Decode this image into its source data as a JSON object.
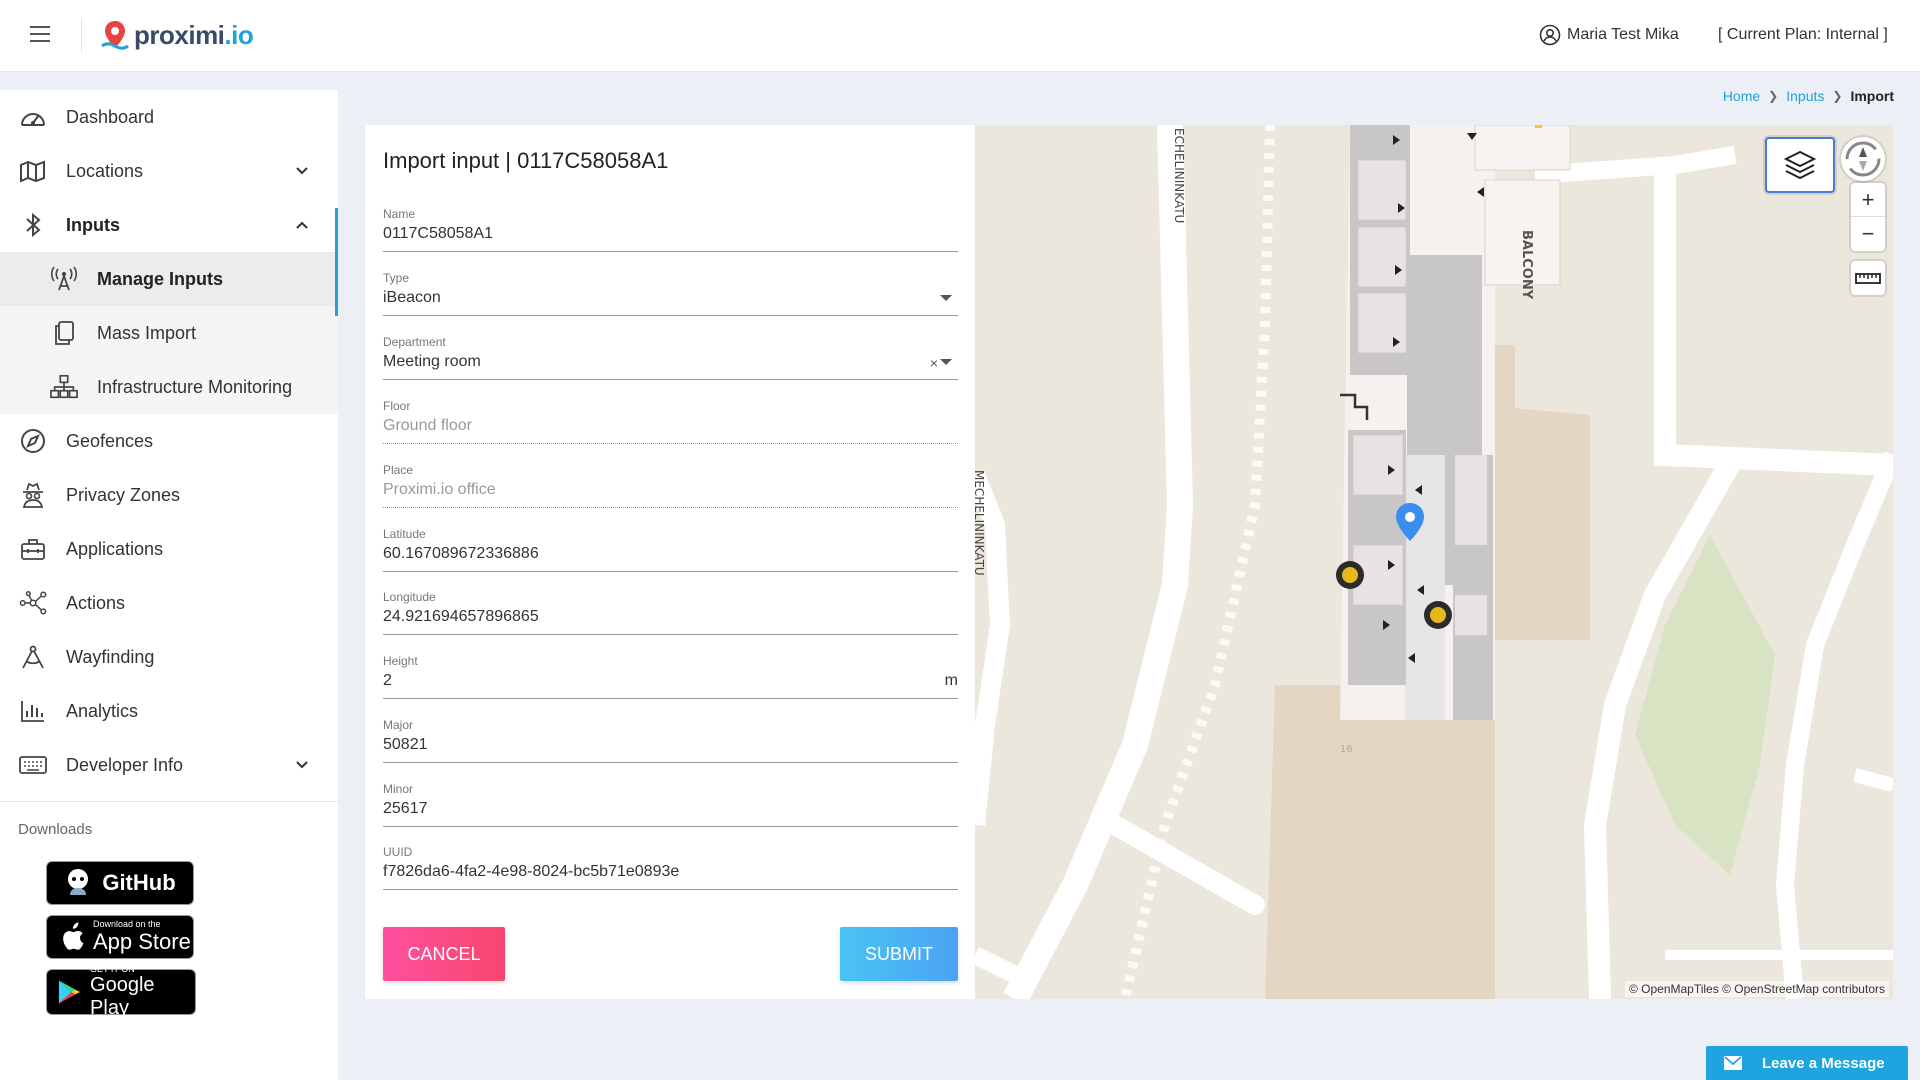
{
  "header": {
    "logo_name": "proximi",
    "logo_suffix": ".io",
    "user_name": "Maria Test Mika",
    "plan": "[ Current Plan: Internal ]"
  },
  "sidebar": {
    "items": [
      {
        "label": "Dashboard",
        "icon": "dashboard-icon"
      },
      {
        "label": "Locations",
        "icon": "map-icon"
      },
      {
        "label": "Inputs",
        "icon": "bluetooth-icon"
      },
      {
        "label": "Manage Inputs",
        "icon": "beacon-icon"
      },
      {
        "label": "Mass Import",
        "icon": "copy-icon"
      },
      {
        "label": "Infrastructure Monitoring",
        "icon": "sitemap-icon"
      },
      {
        "label": "Geofences",
        "icon": "compass-icon"
      },
      {
        "label": "Privacy Zones",
        "icon": "user-secret-icon"
      },
      {
        "label": "Applications",
        "icon": "toolbox-icon"
      },
      {
        "label": "Actions",
        "icon": "network-icon"
      },
      {
        "label": "Wayfinding",
        "icon": "drafting-compass-icon"
      },
      {
        "label": "Analytics",
        "icon": "chart-bar-icon"
      },
      {
        "label": "Developer Info",
        "icon": "keyboard-icon"
      }
    ],
    "downloads_label": "Downloads",
    "github_label": "GitHub",
    "appstore_small": "Download on the",
    "appstore_big": "App Store",
    "googleplay_small": "GET IT ON",
    "googleplay_big": "Google Play"
  },
  "breadcrumb": {
    "home": "Home",
    "inputs": "Inputs",
    "current": "Import"
  },
  "form": {
    "title": "Import input | 0117C58058A1",
    "fields": {
      "name": {
        "label": "Name",
        "value": "0117C58058A1"
      },
      "type": {
        "label": "Type",
        "value": "iBeacon"
      },
      "department": {
        "label": "Department",
        "value": "Meeting room"
      },
      "floor": {
        "label": "Floor",
        "value": "Ground floor"
      },
      "place": {
        "label": "Place",
        "value": "Proximi.io office"
      },
      "latitude": {
        "label": "Latitude",
        "value": "60.167089672336886"
      },
      "longitude": {
        "label": "Longitude",
        "value": "24.921694657896865"
      },
      "height": {
        "label": "Height",
        "value": "2",
        "unit": "m"
      },
      "major": {
        "label": "Major",
        "value": "50821"
      },
      "minor": {
        "label": "Minor",
        "value": "25617"
      },
      "uuid": {
        "label": "UUID",
        "value": "f7826da6-4fa2-4e98-8024-bc5b71e0893e"
      }
    },
    "clear_symbol": "×",
    "cancel_label": "CANCEL",
    "submit_label": "SUBMIT"
  },
  "map": {
    "street_1": "ECHELININKATU",
    "street_2": "MECHELININKATU",
    "balcony": "BALCONY",
    "building_number": "16",
    "zoom_in": "+",
    "zoom_out": "−",
    "attribution": "© OpenMapTiles © OpenStreetMap contributors"
  },
  "chat": {
    "label": "Leave a Message"
  },
  "colors": {
    "accent": "#1fa3d9",
    "cancel": "#f7476e",
    "submit": "#4aa3f5",
    "map_bg": "#ece7dd",
    "marker": "#3a8ef0"
  }
}
